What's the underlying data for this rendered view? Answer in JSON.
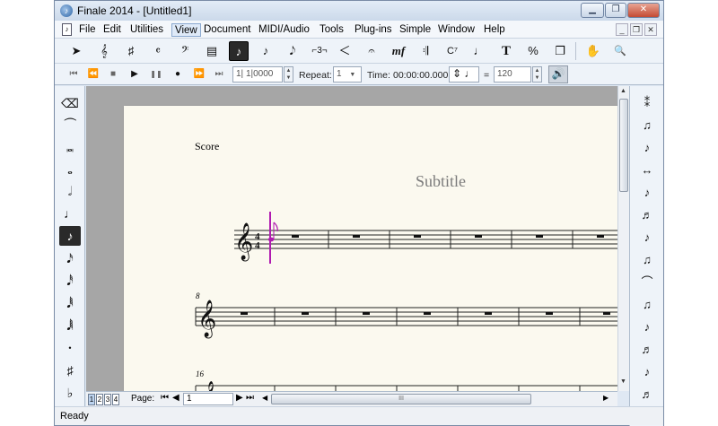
{
  "window": {
    "title": "Finale 2014 - [Untitled1]"
  },
  "menu": [
    "File",
    "Edit",
    "Utilities",
    "View",
    "Document",
    "MIDI/Audio",
    "Tools",
    "Plug-ins",
    "Simple",
    "Window",
    "Help"
  ],
  "active_menu": "View",
  "main_tools": [
    {
      "name": "selection-tool",
      "glyph": "➤"
    },
    {
      "name": "staff-tool",
      "glyph": "𝄞"
    },
    {
      "name": "key-signature-tool",
      "glyph": "♯"
    },
    {
      "name": "time-signature-tool",
      "glyph": "𝄴"
    },
    {
      "name": "clef-tool",
      "glyph": "𝄢"
    },
    {
      "name": "measure-tool",
      "glyph": "▤"
    },
    {
      "name": "simple-entry-tool",
      "glyph": "♪"
    },
    {
      "name": "speedy-entry-tool",
      "glyph": "♪"
    },
    {
      "name": "hyperscribe-tool",
      "glyph": "𝅘𝅥𝅮"
    },
    {
      "name": "tuplet-tool",
      "glyph": "⌐3¬"
    },
    {
      "name": "smart-shape-tool",
      "glyph": "＜"
    },
    {
      "name": "articulation-tool",
      "glyph": "𝄐"
    },
    {
      "name": "expression-tool",
      "glyph": "mf"
    },
    {
      "name": "repeat-tool",
      "glyph": "𝄇"
    },
    {
      "name": "chord-tool",
      "glyph": "C⁷"
    },
    {
      "name": "lyrics-tool",
      "glyph": "♩"
    },
    {
      "name": "text-tool",
      "glyph": "T"
    },
    {
      "name": "resize-tool",
      "glyph": "%"
    },
    {
      "name": "page-layout-tool",
      "glyph": "❐"
    },
    {
      "name": "hand-grabber-tool",
      "glyph": "✋"
    },
    {
      "name": "zoom-tool",
      "glyph": "🔍"
    }
  ],
  "playback": {
    "controls": [
      {
        "name": "rewind-to-start-icon",
        "glyph": "⏮"
      },
      {
        "name": "rewind-icon",
        "glyph": "⏪"
      },
      {
        "name": "stop-icon",
        "glyph": "■"
      },
      {
        "name": "play-icon",
        "glyph": "▶"
      },
      {
        "name": "pause-icon",
        "glyph": "❚❚"
      },
      {
        "name": "record-icon",
        "glyph": "●"
      },
      {
        "name": "fast-forward-icon",
        "glyph": "⏩"
      },
      {
        "name": "forward-to-end-icon",
        "glyph": "⏭"
      }
    ],
    "counter": "1| 1|0000",
    "repeat_label": "Repeat:",
    "repeat_value": "1",
    "time_label": "Time:",
    "time_value": "00:00:00.000",
    "tempo_note_glyph": "♩",
    "equals": "=",
    "tempo": "120"
  },
  "left_palette": [
    {
      "name": "eraser-icon",
      "glyph": "⌫"
    },
    {
      "name": "tie-icon",
      "glyph": "⏜"
    },
    {
      "name": "double-whole-note-icon",
      "glyph": "𝅜"
    },
    {
      "name": "whole-note-icon",
      "glyph": "𝅝"
    },
    {
      "name": "half-note-icon",
      "glyph": "𝅗𝅥"
    },
    {
      "name": "quarter-note-icon",
      "glyph": "♩"
    },
    {
      "name": "eighth-note-icon",
      "glyph": "♪"
    },
    {
      "name": "sixteenth-note-icon",
      "glyph": "𝅘𝅥𝅯"
    },
    {
      "name": "thirty-second-note-icon",
      "glyph": "𝅘𝅥𝅰"
    },
    {
      "name": "sixty-fourth-note-icon",
      "glyph": "𝅘𝅥𝅱"
    },
    {
      "name": "hundred-twenty-eighth-note-icon",
      "glyph": "𝅘𝅥𝅲"
    },
    {
      "name": "dot-icon",
      "glyph": "•"
    },
    {
      "name": "sharp-icon",
      "glyph": "♯"
    },
    {
      "name": "flat-icon",
      "glyph": "♭"
    }
  ],
  "left_selected": "eighth-note-icon",
  "right_palette": [
    {
      "name": "flip-icon",
      "glyph": "⁑"
    },
    {
      "name": "grace-note-icon",
      "glyph": "♫"
    },
    {
      "name": "cue-note-icon",
      "glyph": "♪"
    },
    {
      "name": "courtesy-accidental-icon",
      "glyph": "↔"
    },
    {
      "name": "stem-up-down-icon",
      "glyph": "♪"
    },
    {
      "name": "beam-break-icon",
      "glyph": "♬"
    },
    {
      "name": "tuplet-entry-icon",
      "glyph": "♪"
    },
    {
      "name": "voice-icon",
      "glyph": "♫"
    },
    {
      "name": "slur-icon",
      "glyph": "⌒"
    },
    {
      "name": "chord-stack-icon",
      "glyph": "♫"
    },
    {
      "name": "tie-entry-icon",
      "glyph": "♪"
    },
    {
      "name": "beam-icon",
      "glyph": "♬"
    },
    {
      "name": "beam-extend-icon",
      "glyph": "♪"
    },
    {
      "name": "beam-group-icon",
      "glyph": "♬"
    },
    {
      "name": "beam-feather-icon",
      "glyph": "♪"
    }
  ],
  "score": {
    "label": "Score",
    "subtitle": "Subtitle",
    "measure_numbers": [
      "8",
      "16"
    ],
    "accent_color": "#b01ab0"
  },
  "bottom": {
    "page_tabs": [
      "1",
      "2",
      "3",
      "4"
    ],
    "active_tab": "1",
    "page_label": "Page:",
    "page_value": "1",
    "scroll_grip": "III"
  },
  "status": "Ready"
}
